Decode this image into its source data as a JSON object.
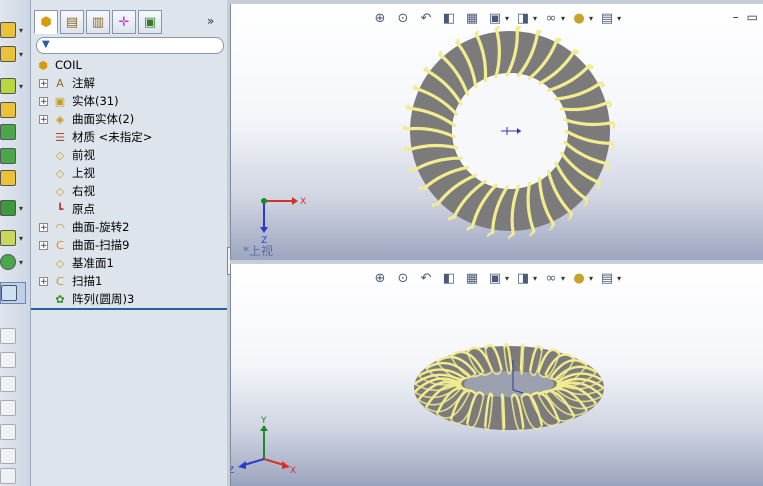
{
  "feature_manager": {
    "tabs": [
      "feature-manager-tab",
      "property-manager-tab",
      "configuration-manager-tab",
      "dimxpert-tab",
      "display-manager-tab"
    ],
    "more_glyph": "»",
    "tree": [
      {
        "label": "COIL",
        "icon": "part-icon",
        "expander": "",
        "root": true
      },
      {
        "label": "注解",
        "icon": "annotations-icon",
        "expander": "+"
      },
      {
        "label": "实体(31)",
        "icon": "solid-bodies-icon",
        "expander": "+"
      },
      {
        "label": "曲面实体(2)",
        "icon": "surface-bodies-icon",
        "expander": "+"
      },
      {
        "label": "材质 <未指定>",
        "icon": "material-icon",
        "expander": ""
      },
      {
        "label": "前视",
        "icon": "plane-icon",
        "expander": ""
      },
      {
        "label": "上视",
        "icon": "plane-icon",
        "expander": ""
      },
      {
        "label": "右视",
        "icon": "plane-icon",
        "expander": ""
      },
      {
        "label": "原点",
        "icon": "origin-icon",
        "expander": ""
      },
      {
        "label": "曲面-旋转2",
        "icon": "revolve-surface-icon",
        "expander": "+"
      },
      {
        "label": "曲面-扫描9",
        "icon": "sweep-surface-icon",
        "expander": "+"
      },
      {
        "label": "基准面1",
        "icon": "plane-icon",
        "expander": ""
      },
      {
        "label": "扫描1",
        "icon": "sweep-icon",
        "expander": "+"
      },
      {
        "label": "阵列(圆周)3",
        "icon": "circular-pattern-icon",
        "expander": ""
      }
    ]
  },
  "viewports": {
    "top": {
      "label": "*上视"
    },
    "bottom": {
      "label": ""
    }
  },
  "window_controls": {
    "minimize": "–",
    "restore": "▭"
  },
  "colors": {
    "coil": "#f2ec8e",
    "core": "#7b7b7b",
    "tree_select": "#2a5ea8"
  }
}
